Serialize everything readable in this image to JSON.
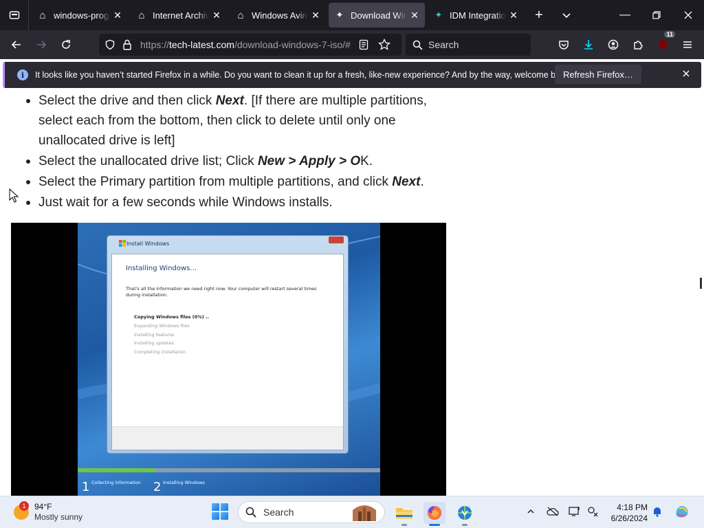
{
  "browser": {
    "tabs": [
      {
        "title": "windows-progress",
        "icon": "archive-building-icon",
        "active": false
      },
      {
        "title": "Internet Archive",
        "icon": "archive-building-icon",
        "active": false
      },
      {
        "title": "Windows Aviro",
        "icon": "archive-building-icon",
        "active": false
      },
      {
        "title": "Download Windows",
        "icon": "tech-latest-icon",
        "active": true
      },
      {
        "title": "IDM Integration",
        "icon": "idm-puzzle-icon",
        "active": false
      }
    ],
    "url_scheme": "https://",
    "url_host": "tech-latest.com",
    "url_path": "/download-windows-7-iso/#",
    "search_placeholder": "Search",
    "extensions_badge": "11",
    "notification": {
      "text": "It looks like you haven’t started Firefox in a while. Do you want to clean it up for a fresh, like-new experience? And by the way, welcome back!",
      "button": "Refresh Firefox…"
    }
  },
  "article": {
    "steps": [
      {
        "parts": [
          {
            "t": "Select the drive and then click ",
            "b": false
          },
          {
            "t": "Next",
            "b": true
          },
          {
            "t": ". [If there are multiple partitions, select each from the bottom, then click to delete until only one unallocated drive is left]",
            "b": false
          }
        ]
      },
      {
        "parts": [
          {
            "t": "Select the unallocated drive list; Click ",
            "b": false
          },
          {
            "t": "New > Apply > O",
            "b": true
          },
          {
            "t": "K.",
            "b": false
          }
        ]
      },
      {
        "parts": [
          {
            "t": "Select the Primary partition from multiple partitions, and click ",
            "b": false
          },
          {
            "t": "Next",
            "b": true
          },
          {
            "t": ".",
            "b": false
          }
        ]
      },
      {
        "parts": [
          {
            "t": "Just wait for a few seconds while Windows installs.",
            "b": false
          }
        ]
      }
    ]
  },
  "install_screen": {
    "window_title": "Install Windows",
    "heading": "Installing Windows...",
    "message": "That's all the information we need right now. Your computer will restart several times during installation.",
    "steps": [
      {
        "label": "Copying Windows files (0%) ..",
        "current": true
      },
      {
        "label": "Expanding Windows files",
        "current": false
      },
      {
        "label": "Installing features",
        "current": false
      },
      {
        "label": "Installing updates",
        "current": false
      },
      {
        "label": "Completing installation",
        "current": false
      }
    ],
    "progress_fraction": 0.26,
    "stages": [
      {
        "num": "1",
        "label": "Collecting information"
      },
      {
        "num": "2",
        "label": "Installing Windows"
      }
    ]
  },
  "taskbar": {
    "weather_temp": "94°F",
    "weather_desc": "Mostly sunny",
    "weather_alert": "1",
    "search_label": "Search",
    "time": "4:18 PM",
    "date": "6/26/2024",
    "apps": [
      "file-explorer-icon",
      "firefox-icon",
      "idm-icon"
    ],
    "tray": [
      "chevron-up-icon",
      "onedrive-offline-icon",
      "display-icon",
      "network-icon",
      "bell-icon",
      "copilot-icon"
    ]
  },
  "colors": {
    "tab_bar": "#1c1b22",
    "nav_bar": "#2b2a33",
    "active_tab": "#42414d",
    "notice_accent": "#c08bff",
    "download_accent": "#0df",
    "taskbar": "#e8eef7"
  }
}
